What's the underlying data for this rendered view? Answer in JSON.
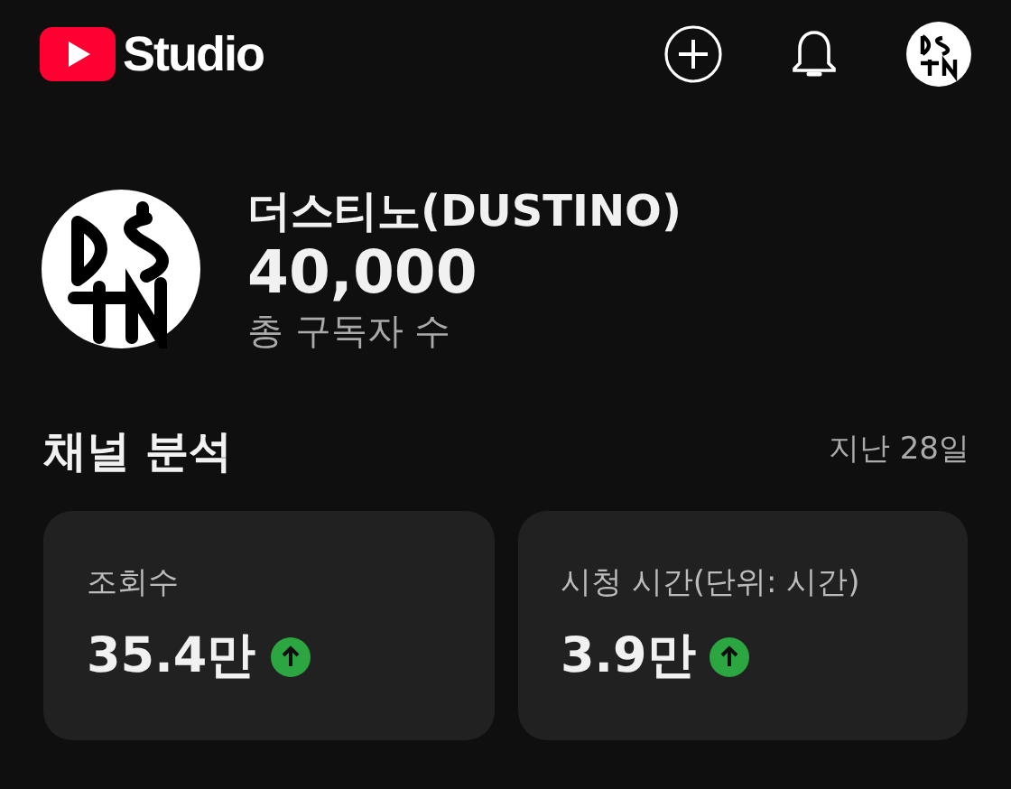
{
  "app_bar": {
    "logo_text": "Studio"
  },
  "channel": {
    "name": "더스티노(DUSTINO)",
    "subscribers": "40,000",
    "subscribers_label": "총 구독자 수"
  },
  "analytics": {
    "title": "채널 분석",
    "period": "지난 28일",
    "metrics": [
      {
        "label": "조회수",
        "value": "35.4만",
        "rising": true
      },
      {
        "label": "시청 시간(단위: 시간)",
        "value": "3.9만",
        "rising": true
      }
    ]
  }
}
